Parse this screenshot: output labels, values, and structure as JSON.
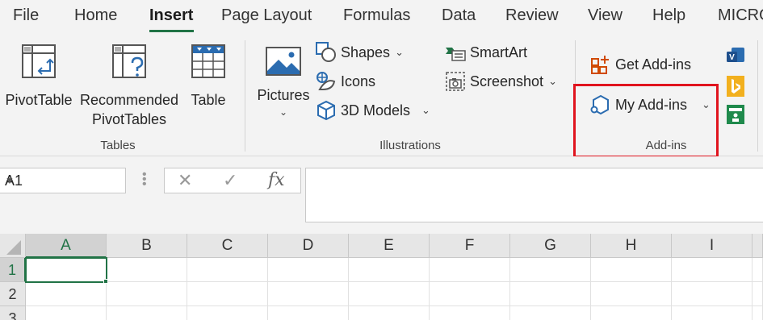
{
  "menu": {
    "tabs": [
      "File",
      "Home",
      "Insert",
      "Page Layout",
      "Formulas",
      "Data",
      "Review",
      "View",
      "Help",
      "MICRO"
    ],
    "active": "Insert"
  },
  "ribbon": {
    "tables": {
      "pivottable": "PivotTable",
      "recommended_1": "Recommended",
      "recommended_2": "PivotTables",
      "table": "Table",
      "label": "Tables"
    },
    "illustrations": {
      "pictures": "Pictures",
      "shapes": "Shapes",
      "icons": "Icons",
      "models": "3D Models",
      "smartart": "SmartArt",
      "screenshot": "Screenshot",
      "label": "Illustrations"
    },
    "addins": {
      "get": "Get Add-ins",
      "my": "My Add-ins",
      "label": "Add-ins"
    }
  },
  "formula_bar": {
    "name_box": "A1",
    "fx": "fx",
    "value": ""
  },
  "grid": {
    "columns": [
      "A",
      "B",
      "C",
      "D",
      "E",
      "F",
      "G",
      "H",
      "I"
    ],
    "rows": [
      "1",
      "2",
      "3"
    ],
    "active_cell": "A1"
  },
  "colors": {
    "accent": "#217346",
    "highlight": "#e0141e",
    "icon_blue": "#2b6cb0"
  }
}
